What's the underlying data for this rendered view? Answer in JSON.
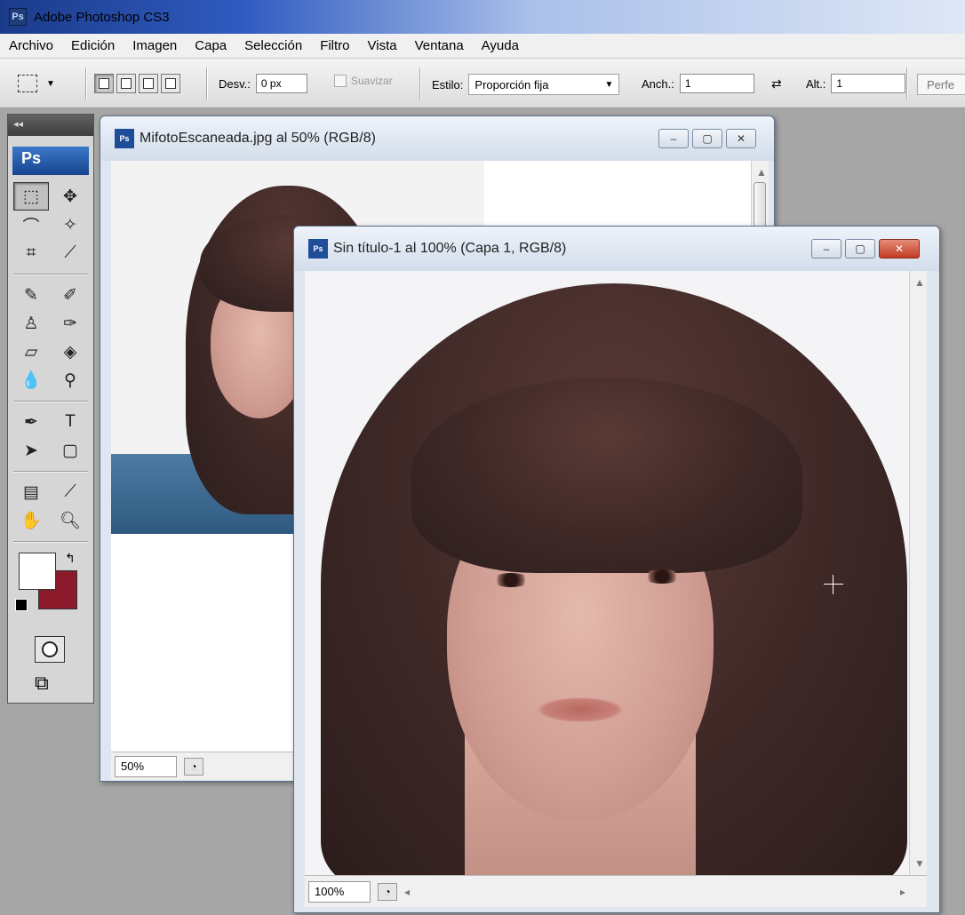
{
  "app": {
    "title": "Adobe Photoshop CS3",
    "badge": "Ps"
  },
  "menu": [
    "Archivo",
    "Edición",
    "Imagen",
    "Capa",
    "Selección",
    "Filtro",
    "Vista",
    "Ventana",
    "Ayuda"
  ],
  "options": {
    "desv_label": "Desv.:",
    "desv_value": "0 px",
    "suavizar_label": "Suavizar",
    "estilo_label": "Estilo:",
    "estilo_value": "Proporción fija",
    "anch_label": "Anch.:",
    "anch_value": "1",
    "alt_label": "Alt.:",
    "alt_value": "1",
    "perf_label": "Perfe"
  },
  "toolbox": {
    "logo": "Ps",
    "colors": {
      "foreground": "#ffffff",
      "background": "#8b1a2a"
    }
  },
  "doc_back": {
    "title": "MifotoEscaneada.jpg al 50% (RGB/8)",
    "zoom": "50%"
  },
  "doc_front": {
    "title": "Sin título-1 al 100% (Capa 1, RGB/8)",
    "zoom": "100%"
  }
}
